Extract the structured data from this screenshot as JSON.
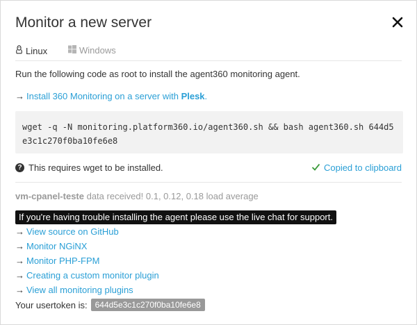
{
  "title": "Monitor a new server",
  "tabs": [
    {
      "label": "Linux",
      "icon": "linux-penguin-icon",
      "active": true
    },
    {
      "label": "Windows",
      "icon": "windows-logo-icon",
      "active": false
    }
  ],
  "intro": "Run the following code as root to install the agent360 monitoring agent.",
  "plesk_link": {
    "prefix": "Install 360 Monitoring on a server with ",
    "bold": "Plesk",
    "suffix": "."
  },
  "code": "wget -q -N monitoring.platform360.io/agent360.sh && bash agent360.sh 644d5e3c1c270f0ba10fe6e8",
  "requirement": "This requires wget to be installed.",
  "copied": "Copied to clipboard",
  "status": {
    "server": "vm-cpanel-teste",
    "text": " data received! 0.1, 0.12, 0.18 load average"
  },
  "tooltip": "If you're having trouble installing the agent please use the live chat for support.",
  "links": [
    "View source on GitHub",
    "Monitor NGiNX",
    "Monitor PHP-FPM",
    "Creating a custom monitor plugin",
    "View all monitoring plugins"
  ],
  "token_label": "Your usertoken is:",
  "token": "644d5e3c1c270f0ba10fe6e8",
  "colors": {
    "link": "#2a9fd6",
    "text": "#333333",
    "muted": "#999999",
    "success": "#3c9c3c"
  }
}
